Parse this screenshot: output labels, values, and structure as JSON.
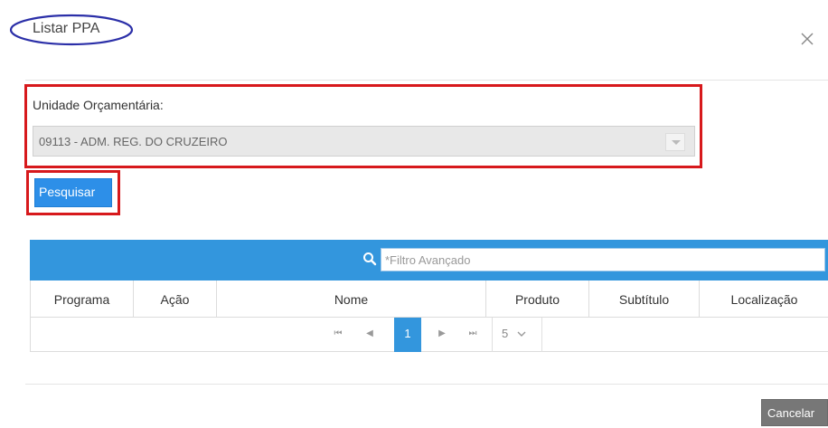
{
  "dialog": {
    "title": "Listar PPA",
    "close_icon": "close-icon"
  },
  "form": {
    "uo_label": "Unidade Orçamentária:",
    "uo_value": "09113 - ADM. REG. DO CRUZEIRO",
    "search_label": "Pesquisar"
  },
  "table": {
    "filter_placeholder": "*Filtro Avançado",
    "filter_icon": "search-icon",
    "header_color": "#3396dd",
    "columns": [
      "Programa",
      "Ação",
      "Nome",
      "Produto",
      "Subtítulo",
      "Localização"
    ]
  },
  "pager": {
    "first": "⏮",
    "prev": "◀",
    "current_page": "1",
    "next": "▶",
    "last": "⏭",
    "page_size": "5"
  },
  "footer": {
    "cancel_label": "Cancelar"
  },
  "colors": {
    "highlight_red": "#d7191c",
    "title_ellipse": "#2b2fa8",
    "primary": "#2d8fe8"
  }
}
